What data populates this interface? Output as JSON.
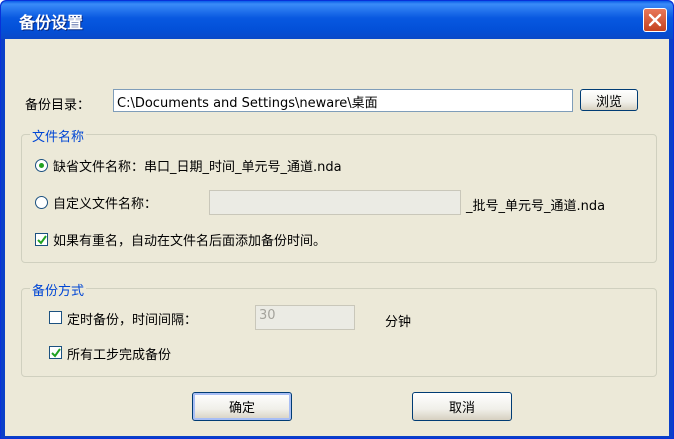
{
  "window": {
    "title": "备份设置"
  },
  "backup_dir": {
    "label": "备份目录：",
    "value": "C:\\Documents and Settings\\neware\\桌面",
    "browse_label": "浏览"
  },
  "filename_group": {
    "legend": "文件名称",
    "default_option": {
      "label": "缺省文件名称：串口_日期_时间_单元号_通道.nda",
      "selected": true
    },
    "custom_option": {
      "label": "自定义文件名称：",
      "value": "",
      "suffix": "_批号_单元号_通道.nda",
      "selected": false
    },
    "append_time": {
      "label": "如果有重名，自动在文件名后面添加备份时间。",
      "checked": true
    }
  },
  "backup_mode_group": {
    "legend": "备份方式",
    "timed": {
      "label": "定时备份，时间间隔：",
      "checked": false,
      "interval": "30",
      "unit": "分钟"
    },
    "all_steps": {
      "label": "所有工步完成备份",
      "checked": true
    }
  },
  "buttons": {
    "ok": "确定",
    "cancel": "取消"
  }
}
